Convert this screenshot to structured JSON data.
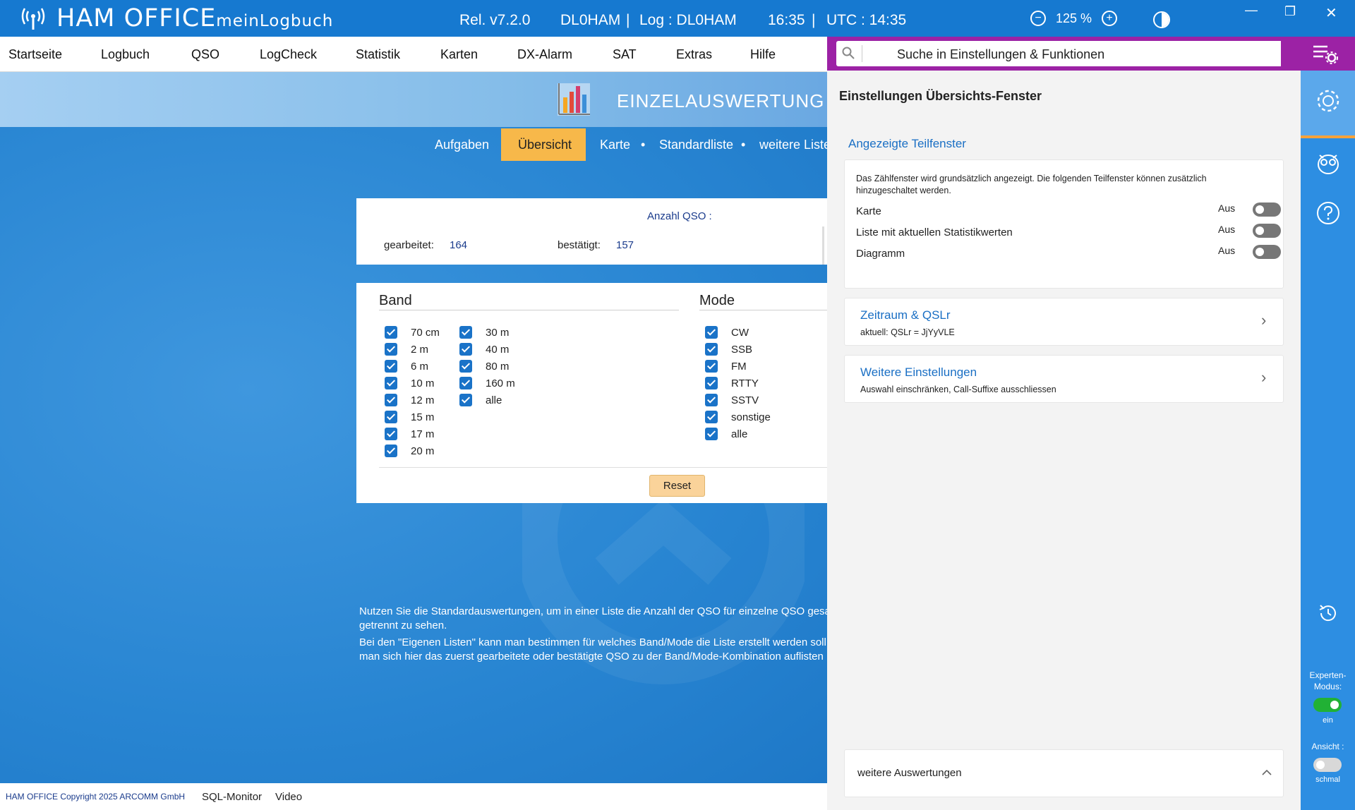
{
  "titlebar": {
    "app_name": "HAM OFFICE",
    "app_sub": ".meinLogbuch",
    "release": "Rel. v7.2.0",
    "callsign": "DL0HAM",
    "sep1": "|",
    "log": "Log : DL0HAM",
    "time": "16:35",
    "sep2": "|",
    "utc": "UTC : 14:35",
    "zoom": "125 %",
    "zoom_minus": "−",
    "zoom_plus": "+"
  },
  "menu": {
    "items": [
      "Startseite",
      "Logbuch",
      "QSO",
      "LogCheck",
      "Statistik",
      "Karten",
      "DX-Alarm",
      "SAT",
      "Extras",
      "Hilfe"
    ]
  },
  "banner": {
    "title": "EINZELAUSWERTUNG"
  },
  "subnav": {
    "items": [
      "Aufgaben",
      "Übersicht",
      "Karte",
      "Standardliste",
      "weitere Liste"
    ],
    "active": "Übersicht",
    "dot": "•"
  },
  "counts": {
    "title": "Anzahl QSO :",
    "worked_label": "gearbeitet:",
    "worked_value": "164",
    "confirmed_label": "bestätigt:",
    "confirmed_value": "157"
  },
  "filter": {
    "band_title": "Band",
    "mode_title": "Mode",
    "bands_col1": [
      "70 cm",
      "2 m",
      "6 m",
      "10 m",
      "12 m",
      "15 m",
      "17 m",
      "20 m"
    ],
    "bands_col2": [
      "30 m",
      "40 m",
      "80 m",
      "160 m",
      "alle"
    ],
    "modes": [
      "CW",
      "SSB",
      "FM",
      "RTTY",
      "SSTV",
      "sonstige",
      "alle"
    ],
    "reset_label": "Reset"
  },
  "info": {
    "line1": "Nutzen Sie die Standardauswertungen, um in einer Liste die Anzahl der QSO für einzelne QSO gesam",
    "line2": "getrennt zu sehen.",
    "line3": "Bei den \"Eigenen Listen\" kann man bestimmen für welches Band/Mode die Liste erstellt werden soll.",
    "line4": "man sich hier das zuerst gearbeitete oder bestätigte QSO zu der Band/Mode-Kombination auflisten"
  },
  "statusbar": {
    "copyright": "HAM OFFICE Copyright 2025 ARCOMM GmbH",
    "sql_monitor": "SQL-Monitor",
    "video": "Video"
  },
  "search": {
    "placeholder": "Suche in Einstellungen & Funktionen"
  },
  "settings": {
    "title": "Einstellungen Übersichts-Fenster",
    "section1_title": "Angezeigte Teilfenster",
    "section1_desc_1": "Das Zählfenster wird grundsätzlich angezeigt. Die folgenden Teilfenster können zusätzlich",
    "section1_desc_2": "hinzugeschaltet werden.",
    "toggles": [
      {
        "label": "Karte",
        "state": "Aus"
      },
      {
        "label": "Liste mit aktuellen Statistikwerten",
        "state": "Aus"
      },
      {
        "label": "Diagramm",
        "state": "Aus"
      }
    ],
    "card2_title": "Zeitraum & QSLr",
    "card2_sub": "aktuell: QSLr = JjYyVLE",
    "card3_title": "Weitere Einstellungen",
    "card3_sub": "Auswahl einschränken, Call-Suffixe ausschliessen",
    "footer_label": "weitere Auswertungen"
  },
  "sidebar": {
    "expert_label_1": "Experten-",
    "expert_label_2": "Modus:",
    "expert_state": "ein",
    "view_label": "Ansicht :",
    "view_state": "schmal"
  },
  "colors": {
    "accent_blue": "#1679d0",
    "purple": "#9c22a5",
    "active_tab": "#f7b84a",
    "link_blue": "#1a6fc4"
  }
}
